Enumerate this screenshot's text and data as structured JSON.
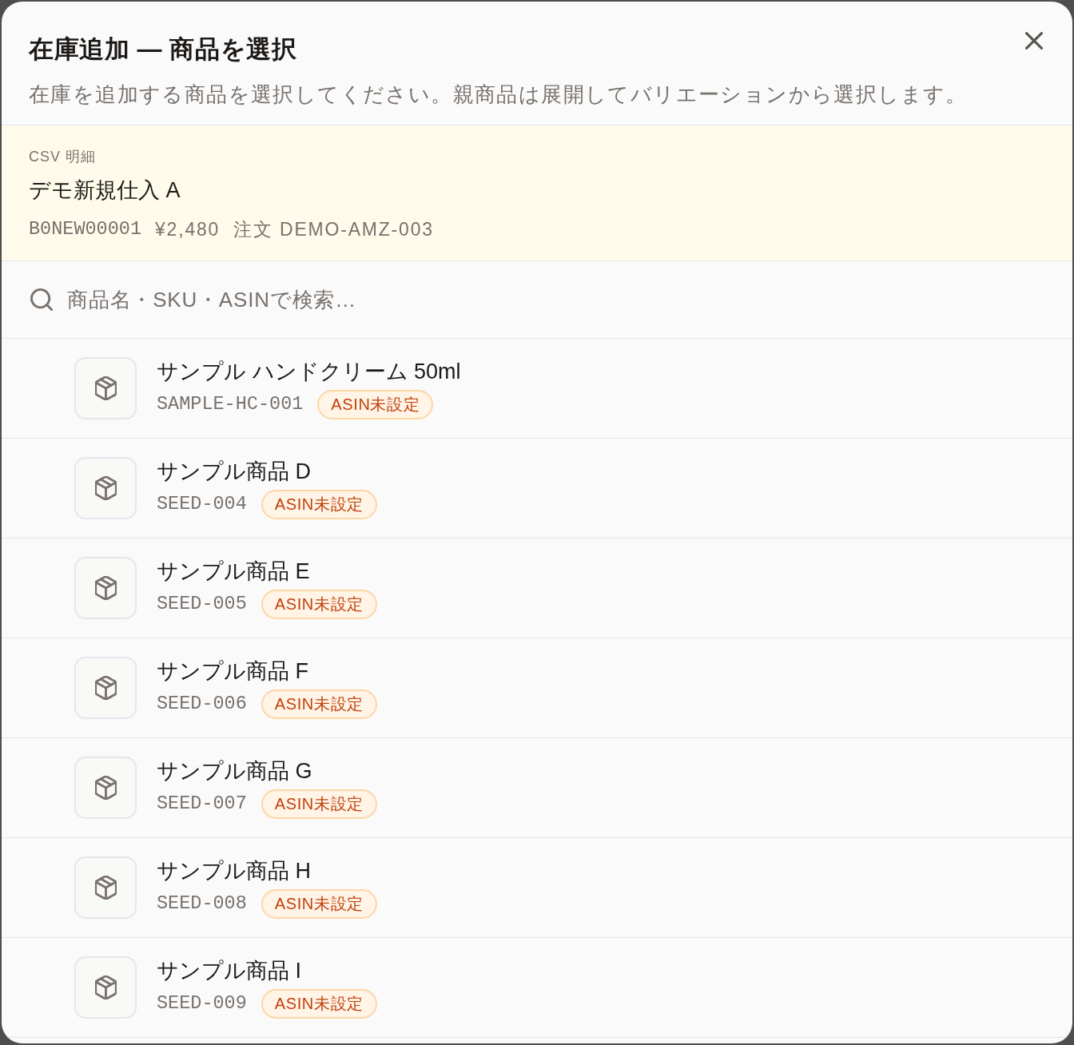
{
  "dialog": {
    "title": "在庫追加 — 商品を選択",
    "description": "在庫を追加する商品を選択してください。親商品は展開してバリエーションから選択します。"
  },
  "csv_detail": {
    "label": "CSV 明細",
    "name": "デモ新規仕入 A",
    "asin": "B0NEW00001",
    "price": "¥2,480",
    "order": "注文 DEMO-AMZ-003"
  },
  "search": {
    "placeholder": "商品名・SKU・ASINで検索…"
  },
  "products": [
    {
      "name": "サンプル ハンドクリーム 50ml",
      "sku": "SAMPLE-HC-001",
      "tag": "ASIN未設定",
      "selected": false
    },
    {
      "name": "サンプル商品 D",
      "sku": "SEED-004",
      "tag": "ASIN未設定",
      "selected": false
    },
    {
      "name": "サンプル商品 E",
      "sku": "SEED-005",
      "tag": "ASIN未設定",
      "selected": false
    },
    {
      "name": "サンプル商品 F",
      "sku": "SEED-006",
      "tag": "ASIN未設定",
      "selected": false
    },
    {
      "name": "サンプル商品 G",
      "sku": "SEED-007",
      "tag": "ASIN未設定",
      "selected": false
    },
    {
      "name": "サンプル商品 H",
      "sku": "SEED-008",
      "tag": "ASIN未設定",
      "selected": false
    },
    {
      "name": "サンプル商品 I",
      "sku": "SEED-009",
      "tag": "ASIN未設定",
      "selected": false
    }
  ]
}
